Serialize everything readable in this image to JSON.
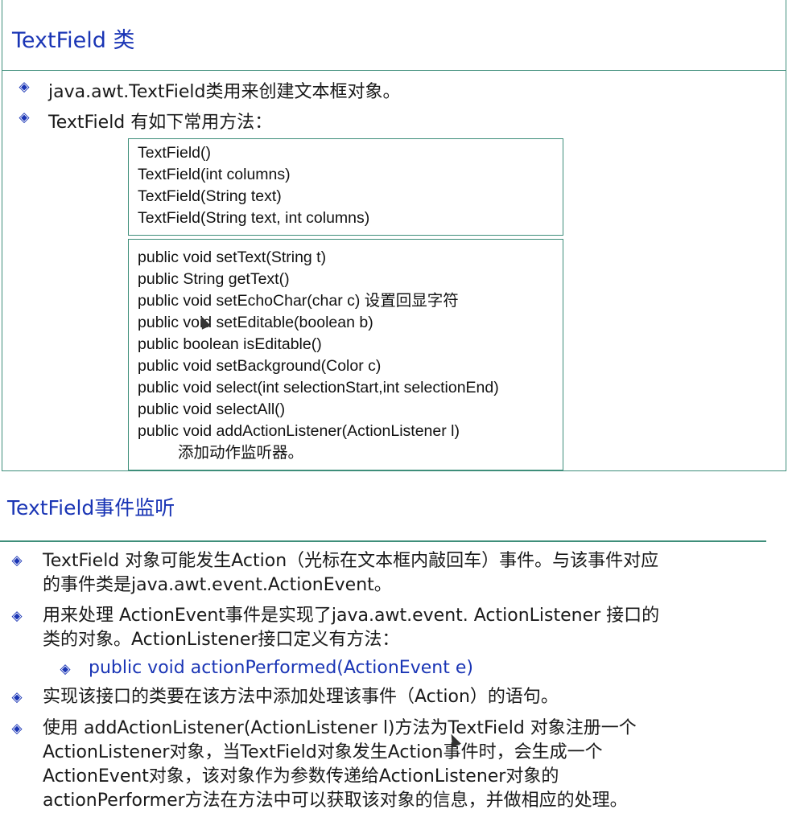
{
  "slide1": {
    "title": "TextField 类",
    "bullets": [
      "java.awt.TextField类用来创建文本框对象。",
      "TextField 有如下常用方法："
    ],
    "constructors": [
      "TextField()",
      "TextField(int columns)",
      "TextField(String text)",
      "TextField(String text, int columns)"
    ],
    "methods": [
      "public void setText(String t)",
      "public String getText()",
      "public void setEchoChar(char c) 设置回显字符",
      "public void setEditable(boolean b)",
      "public boolean isEditable()",
      "public void setBackground(Color c)",
      "public void select(int selectionStart,int selectionEnd)",
      "public void selectAll()",
      "public void addActionListener(ActionListener l)",
      "添加动作监听器。"
    ]
  },
  "slide2": {
    "title": "TextField事件监听",
    "paragraphs": [
      [
        "TextField 对象可能发生Action（光标在文本框内敲回车）事件。与该事件对应",
        "的事件类是java.awt.event.ActionEvent。"
      ],
      [
        "用来处理 ActionEvent事件是实现了java.awt.event. ActionListener 接口的",
        "类的对象。ActionListener接口定义有方法："
      ],
      [
        "实现该接口的类要在该方法中添加处理该事件（Action）的语句。"
      ],
      [
        "使用 addActionListener(ActionListener l)方法为TextField 对象注册一个",
        "ActionListener对象，当TextField对象发生Action事件时，会生成一个",
        "ActionEvent对象，该对象作为参数传递给ActionListener对象的",
        "actionPerformer方法在方法中可以获取该对象的信息，并做相应的处理。"
      ]
    ],
    "sub_bullet": "public void actionPerformed(ActionEvent e)"
  },
  "bullet_icon": "diamond-bullet-icon",
  "colors": {
    "accent": "#1a35b5",
    "frame": "#3e8e7a"
  }
}
